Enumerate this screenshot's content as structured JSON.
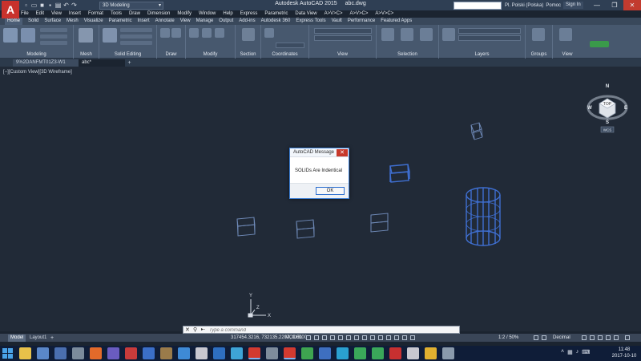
{
  "titlebar": {
    "app_logo": "A",
    "workspace": "3D Modeling",
    "app_name": "Autodesk AutoCAD 2015",
    "file_name": "abc.dwg",
    "search_placeholder": "Type a keyword or phrase",
    "user": "Pl. Polski (Polska)",
    "user_extra": "Pomoc",
    "signin": "Sign In",
    "qat_icons": [
      "new-icon",
      "open-icon",
      "save-icon",
      "save-as-icon",
      "print-icon",
      "undo-icon",
      "redo-icon"
    ]
  },
  "menubar": [
    "File",
    "Edit",
    "View",
    "Insert",
    "Format",
    "Tools",
    "Draw",
    "Dimension",
    "Modify",
    "Window",
    "Help",
    "Express",
    "Parametric",
    "Data View",
    "A>V>C>",
    "A>V>C>",
    "A>V>C>"
  ],
  "ribbon_tabs": {
    "active": "Home",
    "others": [
      "Solid",
      "Surface",
      "Mesh",
      "Visualize",
      "Parametric",
      "Insert",
      "Annotate",
      "View",
      "Manage",
      "Output",
      "Add-ins",
      "Autodesk 360",
      "Express Tools",
      "Vault",
      "Performance",
      "Featured Apps"
    ]
  },
  "ribbon_panels": {
    "modeling": "Modeling",
    "mesh": "Mesh",
    "solid_editing": "Solid Editing",
    "draw": "Draw",
    "modify": "Modify",
    "section": "Section",
    "coordinates": "Coordinates",
    "view": "View",
    "selection": "Selection",
    "layers": "Layers",
    "groups": "Groups",
    "view2": "View"
  },
  "file_tabs": {
    "tab1": "9%2DANFMT01Z3-W1 Rev.02",
    "tab2": "abc*"
  },
  "viewport": {
    "view_label": "[−][Custom View][3D Wireframe]",
    "compass": {
      "n": "N",
      "e": "E",
      "s": "S",
      "w": "W",
      "top": "TOP",
      "wcs": "WCS"
    },
    "ucs": {
      "x": "X",
      "y": "Y",
      "z": "Z"
    }
  },
  "dialog": {
    "title": "AutoCAD Message",
    "message": "SOLIDs Are Indentical",
    "ok": "OK"
  },
  "cmdline": {
    "placeholder": "Type a command",
    "prompt_icon": "▸-"
  },
  "layout_tabs": {
    "model": "Model",
    "layout1": "Layout1"
  },
  "statusbar": {
    "coords": "317454.3216, 732135.2207, 0.0000",
    "model": "MODEL",
    "scale": "1:2 / 50%",
    "units": "Decimal"
  },
  "taskbar": {
    "apps": [
      {
        "name": "file-explorer-icon",
        "color": "#e8c14a"
      },
      {
        "name": "task-view-icon",
        "color": "#5a87c8"
      },
      {
        "name": "app3-icon",
        "color": "#4a6fb0"
      },
      {
        "name": "app4-icon",
        "color": "#7b8b9c"
      },
      {
        "name": "firefox-icon",
        "color": "#e36a2a"
      },
      {
        "name": "app6-icon",
        "color": "#6a5cc0"
      },
      {
        "name": "app7-icon",
        "color": "#c83b3b"
      },
      {
        "name": "app8-icon",
        "color": "#3b6fc8"
      },
      {
        "name": "app9-icon",
        "color": "#9a7b4a"
      },
      {
        "name": "app10-icon",
        "color": "#3e8ad6"
      },
      {
        "name": "app11-icon",
        "color": "#c8c8d0"
      },
      {
        "name": "app12-icon",
        "color": "#2e6fc0"
      },
      {
        "name": "app13-icon",
        "color": "#3ea4d6"
      },
      {
        "name": "autocad-icon",
        "color": "#d23a30"
      },
      {
        "name": "app15-icon",
        "color": "#7e8c9c"
      },
      {
        "name": "autocad2-icon",
        "color": "#d23a30"
      },
      {
        "name": "app17-icon",
        "color": "#3ea550"
      },
      {
        "name": "app18-icon",
        "color": "#3e6fc0"
      },
      {
        "name": "app19-icon",
        "color": "#2aa0d0"
      },
      {
        "name": "app20-icon",
        "color": "#3aa85a"
      },
      {
        "name": "app21-icon",
        "color": "#3aa85a"
      },
      {
        "name": "app22-icon",
        "color": "#c83030"
      },
      {
        "name": "app23-icon",
        "color": "#c8c8d0"
      },
      {
        "name": "chrome-icon",
        "color": "#e0b030"
      },
      {
        "name": "app25-icon",
        "color": "#8a9aac"
      }
    ],
    "time": "11:48",
    "date": "2017-10-10"
  },
  "colors": {
    "viewport_bg": "#212a37",
    "wire": "#3f6fd1",
    "wire_light": "#6f8ab8"
  }
}
